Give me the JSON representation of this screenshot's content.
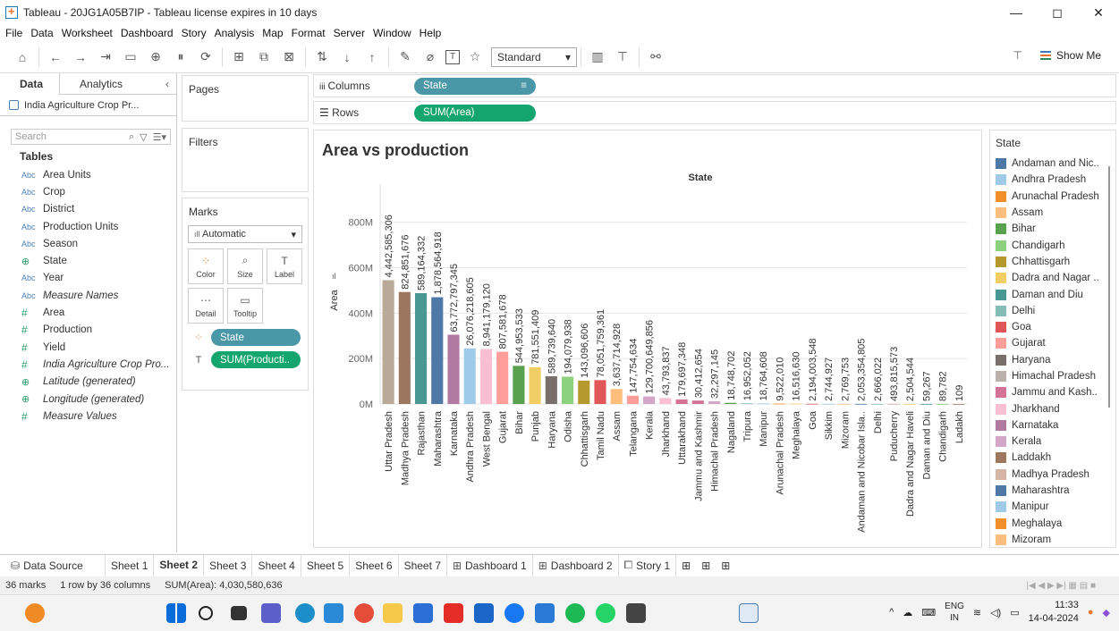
{
  "window": {
    "title": "Tableau - 20JG1A05B7IP - Tableau license expires in 10 days",
    "controls": [
      "—",
      "◻",
      "✕"
    ]
  },
  "menu": [
    "File",
    "Data",
    "Worksheet",
    "Dashboard",
    "Story",
    "Analysis",
    "Map",
    "Format",
    "Server",
    "Window",
    "Help"
  ],
  "toolbar": {
    "fit_select": "Standard",
    "show_me_label": "Show Me"
  },
  "left_pane": {
    "tabs": [
      "Data",
      "Analytics"
    ],
    "datasource": "India Agriculture Crop Pr...",
    "search_placeholder": "Search",
    "tables_header": "Tables",
    "fields": [
      {
        "type": "Abc",
        "name": "Area Units",
        "italic": false,
        "kind": "str"
      },
      {
        "type": "Abc",
        "name": "Crop",
        "italic": false,
        "kind": "str"
      },
      {
        "type": "Abc",
        "name": "District",
        "italic": false,
        "kind": "str"
      },
      {
        "type": "Abc",
        "name": "Production Units",
        "italic": false,
        "kind": "str"
      },
      {
        "type": "Abc",
        "name": "Season",
        "italic": false,
        "kind": "str"
      },
      {
        "type": "⊕",
        "name": "State",
        "italic": false,
        "kind": "geo"
      },
      {
        "type": "Abc",
        "name": "Year",
        "italic": false,
        "kind": "str"
      },
      {
        "type": "Abc",
        "name": "Measure Names",
        "italic": true,
        "kind": "str"
      },
      {
        "type": "#",
        "name": "Area",
        "italic": false,
        "kind": "num"
      },
      {
        "type": "#",
        "name": "Production",
        "italic": false,
        "kind": "num"
      },
      {
        "type": "#",
        "name": "Yield",
        "italic": false,
        "kind": "num"
      },
      {
        "type": "#",
        "name": "India Agriculture Crop Pro...",
        "italic": true,
        "kind": "num"
      },
      {
        "type": "⊕",
        "name": "Latitude (generated)",
        "italic": true,
        "kind": "geo"
      },
      {
        "type": "⊕",
        "name": "Longitude (generated)",
        "italic": true,
        "kind": "geo"
      },
      {
        "type": "#",
        "name": "Measure Values",
        "italic": true,
        "kind": "num"
      }
    ]
  },
  "cards": {
    "pages": "Pages",
    "filters": "Filters",
    "marks": "Marks",
    "mark_type": "Automatic",
    "mark_buttons": [
      {
        "label": "Color",
        "icon": "color-icon"
      },
      {
        "label": "Size",
        "icon": "size-icon"
      },
      {
        "label": "Label",
        "icon": "label-icon"
      },
      {
        "label": "Detail",
        "icon": "detail-icon"
      },
      {
        "label": "Tooltip",
        "icon": "tooltip-icon"
      }
    ],
    "mark_pills": [
      {
        "label": "State",
        "color": "blue"
      },
      {
        "label": "SUM(Producti..",
        "color": "green"
      }
    ]
  },
  "shelves": {
    "columns_label": "Columns",
    "columns_pill": "State",
    "rows_label": "Rows",
    "rows_pill": "SUM(Area)"
  },
  "viz": {
    "title": "Area vs production"
  },
  "chart_data": {
    "type": "bar",
    "title": "Area vs production",
    "header": "State",
    "ylabel": "Area",
    "ylim": [
      0,
      850000000
    ],
    "yticks": [
      0,
      200000000,
      400000000,
      600000000,
      800000000
    ],
    "ytick_labels": [
      "0M",
      "200M",
      "400M",
      "600M",
      "800M"
    ],
    "grid": true,
    "categories": [
      "Uttar Pradesh",
      "Madhya Pradesh",
      "Rajasthan",
      "Maharashtra",
      "Karnataka",
      "Andhra Pradesh",
      "West Bengal",
      "Gujarat",
      "Bihar",
      "Punjab",
      "Haryana",
      "Odisha",
      "Chhattisgarh",
      "Tamil Nadu",
      "Assam",
      "Telangana",
      "Kerala",
      "Jharkhand",
      "Uttarakhand",
      "Jammu and Kashmir",
      "Himachal Pradesh",
      "Nagaland",
      "Tripura",
      "Manipur",
      "Arunachal Pradesh",
      "Meghalaya",
      "Goa",
      "Sikkim",
      "Mizoram",
      "Andaman and Nicobar Isla..",
      "Delhi",
      "Puducherry",
      "Dadra and Nagar Haveli",
      "Daman and Diu",
      "Chandigarh",
      "Ladakh"
    ],
    "values": [
      545000000,
      493000000,
      488000000,
      470000000,
      305000000,
      245000000,
      242000000,
      230000000,
      168000000,
      162000000,
      122000000,
      120000000,
      103000000,
      105000000,
      66000000,
      36000000,
      33000000,
      26000000,
      20000000,
      15000000,
      12000000,
      5000000,
      3000000,
      2500000,
      1500000,
      1500000,
      800000,
      500000,
      500000,
      300000,
      200000,
      150000,
      100000,
      50000,
      20000,
      5000
    ],
    "data_labels": [
      "4,442,585,306",
      "824,851,676",
      "589,164,332",
      "1,878,564,918",
      "63,772,797,345",
      "26,076,218,605",
      "8,941,179,120",
      "807,581,678",
      "544,953,533",
      "781,551,409",
      "589,739,640",
      "194,079,938",
      "143,096,606",
      "78,051,759,361",
      "3,637,714,928",
      "147,754,634",
      "129,700,649,856",
      "43,793,837",
      "179,697,348",
      "30,412,654",
      "32,297,145",
      "18,748,702",
      "16,952,052",
      "18,764,608",
      "9,522,010",
      "16,516,630",
      "2,194,003,548",
      "2,744,927",
      "2,769,753",
      "2,053,354,805",
      "2,666,022",
      "493,815,573",
      "2,504,544",
      "59,267",
      "89,782",
      "109"
    ],
    "colors": [
      "#b9aa97",
      "#9d7660",
      "#499894",
      "#4e79a7",
      "#b07aa1",
      "#a0cbe8",
      "#fabfd2",
      "#ff9d9a",
      "#59a14f",
      "#f1ce63",
      "#79706e",
      "#8cd17d",
      "#b6992d",
      "#e15759",
      "#ffbe7d",
      "#ff9d9a",
      "#d4a6c8",
      "#fabfd2",
      "#d37295",
      "#d37295",
      "#d4a6c8",
      "#59a14f",
      "#86bcb6",
      "#a0cbe8",
      "#f28e2b",
      "#f1ce63",
      "#e15759",
      "#a0cbe8",
      "#ffbe7d",
      "#4e79a7",
      "#86bcb6",
      "#d7b5a6",
      "#f1ce63",
      "#499894",
      "#8cd17d",
      "#9d7660"
    ]
  },
  "legend": {
    "title": "State",
    "items": [
      {
        "label": "Andaman and Nic..",
        "color": "#4e79a7"
      },
      {
        "label": "Andhra Pradesh",
        "color": "#a0cbe8"
      },
      {
        "label": "Arunachal Pradesh",
        "color": "#f28e2b"
      },
      {
        "label": "Assam",
        "color": "#ffbe7d"
      },
      {
        "label": "Bihar",
        "color": "#59a14f"
      },
      {
        "label": "Chandigarh",
        "color": "#8cd17d"
      },
      {
        "label": "Chhattisgarh",
        "color": "#b6992d"
      },
      {
        "label": "Dadra and Nagar ..",
        "color": "#f1ce63"
      },
      {
        "label": "Daman and Diu",
        "color": "#499894"
      },
      {
        "label": "Delhi",
        "color": "#86bcb6"
      },
      {
        "label": "Goa",
        "color": "#e15759"
      },
      {
        "label": "Gujarat",
        "color": "#ff9d9a"
      },
      {
        "label": "Haryana",
        "color": "#79706e"
      },
      {
        "label": "Himachal Pradesh",
        "color": "#bab0ac"
      },
      {
        "label": "Jammu and Kash..",
        "color": "#d37295"
      },
      {
        "label": "Jharkhand",
        "color": "#fabfd2"
      },
      {
        "label": "Karnataka",
        "color": "#b07aa1"
      },
      {
        "label": "Kerala",
        "color": "#d4a6c8"
      },
      {
        "label": "Laddakh",
        "color": "#9d7660"
      },
      {
        "label": "Madhya Pradesh",
        "color": "#d7b5a6"
      },
      {
        "label": "Maharashtra",
        "color": "#4e79a7"
      },
      {
        "label": "Manipur",
        "color": "#a0cbe8"
      },
      {
        "label": "Meghalaya",
        "color": "#f28e2b"
      },
      {
        "label": "Mizoram",
        "color": "#ffbe7d"
      }
    ]
  },
  "sheet_tabs": [
    {
      "label": "Data Source",
      "icon": "datasource-icon",
      "active": false
    },
    {
      "label": "Sheet 1",
      "icon": "",
      "active": false
    },
    {
      "label": "Sheet 2",
      "icon": "",
      "active": true
    },
    {
      "label": "Sheet 3",
      "icon": "",
      "active": false
    },
    {
      "label": "Sheet 4",
      "icon": "",
      "active": false
    },
    {
      "label": "Sheet 5",
      "icon": "",
      "active": false
    },
    {
      "label": "Sheet 6",
      "icon": "",
      "active": false
    },
    {
      "label": "Sheet 7",
      "icon": "",
      "active": false
    },
    {
      "label": "Dashboard 1",
      "icon": "dashboard-icon",
      "active": false
    },
    {
      "label": "Dashboard 2",
      "icon": "dashboard-icon",
      "active": false
    },
    {
      "label": "Story 1",
      "icon": "story-icon",
      "active": false
    }
  ],
  "status": {
    "marks": "36 marks",
    "layout": "1 row by 36 columns",
    "sum": "SUM(Area): 4,030,580,636"
  },
  "taskbar": {
    "lang_top": "ENG",
    "lang_bottom": "IN",
    "time": "11:33",
    "date": "14-04-2024"
  }
}
